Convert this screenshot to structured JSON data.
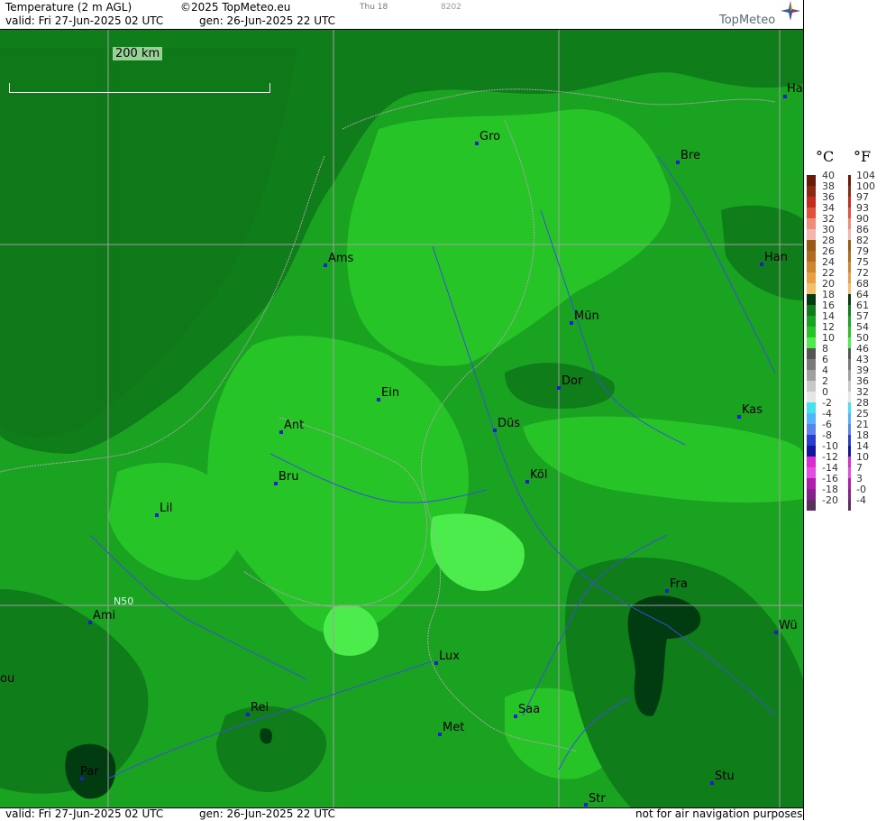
{
  "header": {
    "title": "Temperature (2 m AGL)",
    "copyright": "©2025 TopMeteo.eu",
    "day_tag": "Thu 18",
    "code": "8202",
    "valid": "valid:  Fri  27-Jun-2025  02 UTC",
    "generated": "gen:  26-Jun-2025  22 UTC",
    "brand": "TopMeteo"
  },
  "footer": {
    "valid": "valid:  Fri  27-Jun-2025  02 UTC",
    "generated": "gen:  26-Jun-2025  22 UTC",
    "disclaimer": "not for air navigation purposes"
  },
  "map": {
    "scale_label": "200 km",
    "latitude_label": "N50",
    "cities": [
      "Ha",
      "Gro",
      "Bre",
      "Ams",
      "Han",
      "Mün",
      "Dor",
      "Ein",
      "Kas",
      "Ant",
      "Düs",
      "Köl",
      "Bru",
      "Lil",
      "Fra",
      "Ami",
      "Wü",
      "ou",
      "Lux",
      "Saa",
      "Rei",
      "Met",
      "Par",
      "Stu",
      "Str"
    ]
  },
  "legend": {
    "unit_c": "°C",
    "unit_f": "°F",
    "celsius": [
      "40",
      "38",
      "36",
      "34",
      "32",
      "30",
      "28",
      "26",
      "24",
      "22",
      "20",
      "18",
      "16",
      "14",
      "12",
      "10",
      "8",
      "6",
      "4",
      "2",
      "0",
      "-2",
      "-4",
      "-6",
      "-8",
      "-10",
      "-12",
      "-14",
      "-16",
      "-18",
      "-20"
    ],
    "fahrenheit": [
      "104",
      "100",
      "97",
      "93",
      "90",
      "86",
      "82",
      "79",
      "75",
      "72",
      "68",
      "64",
      "61",
      "57",
      "54",
      "50",
      "46",
      "43",
      "39",
      "36",
      "32",
      "28",
      "25",
      "21",
      "18",
      "14",
      "10",
      "7",
      "3",
      "-0",
      "-4"
    ],
    "colors": [
      "#6b1a0a",
      "#8b2a10",
      "#c42d1e",
      "#e4503a",
      "#f08c7c",
      "#f5b4ac",
      "#9a5a14",
      "#b26a1c",
      "#d0862a",
      "#e8a040",
      "#f2c068",
      "#003c10",
      "#0e7d1a",
      "#1aa321",
      "#27c427",
      "#4bec4b",
      "#555555",
      "#7a7a7a",
      "#a0a0a0",
      "#c8c8c8",
      "#e6e6e6",
      "#44e2f0",
      "#50b4ff",
      "#5a82f0",
      "#2a3cd2",
      "#1414a0",
      "#dc2bd0",
      "#e44ce4",
      "#b01cb0",
      "#86208a",
      "#5a3060"
    ]
  }
}
